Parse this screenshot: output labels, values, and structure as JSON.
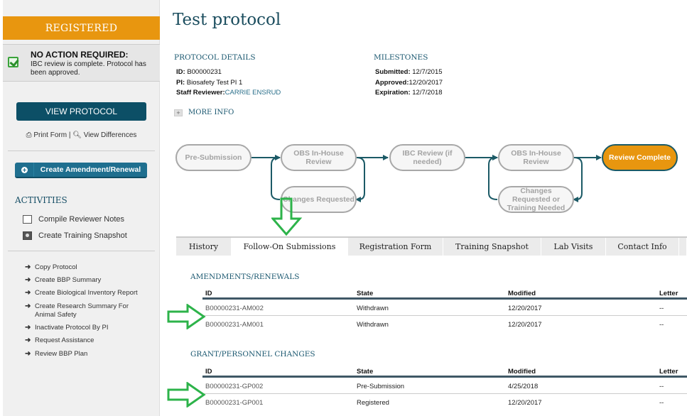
{
  "sidebar": {
    "status": "REGISTERED",
    "notice": {
      "title": "NO ACTION REQUIRED:",
      "body": "IBC review is complete. Protocol has been approved."
    },
    "view_protocol_label": "VIEW PROTOCOL",
    "print_form_label": "Print Form",
    "separator": "|",
    "view_differences_label": "View Differences",
    "create_amendment_label": "Create Amendment/Renewal",
    "activities_title": "ACTIVITIES",
    "activities": [
      {
        "label": "Compile Reviewer Notes",
        "icon": "note-icon"
      },
      {
        "label": "Create Training Snapshot",
        "icon": "camera-icon"
      }
    ],
    "links": [
      {
        "label": "Copy Protocol"
      },
      {
        "label": "Create BBP Summary"
      },
      {
        "label": "Create Biological Inventory Report"
      },
      {
        "label": "Create Research Summary For Animal Safety"
      },
      {
        "label": "Inactivate Protocol By PI"
      },
      {
        "label": "Request Assistance"
      },
      {
        "label": "Review BBP Plan"
      }
    ]
  },
  "main": {
    "title": "Test protocol",
    "protocol_details": {
      "heading": "PROTOCOL DETAILS",
      "id_label": "ID:",
      "id_value": "B00000231",
      "pi_label": "PI:",
      "pi_value": "Biosafety Test PI 1",
      "reviewer_label": "Staff Reviewer:",
      "reviewer_value": "CARRIE ENSRUD"
    },
    "milestones": {
      "heading": "MILESTONES",
      "submitted_label": "Submitted:",
      "submitted_value": "12/7/2015",
      "approved_label": "Approved:",
      "approved_value": "12/20/2017",
      "expiration_label": "Expiration:",
      "expiration_value": "12/7/2018"
    },
    "more_info_label": "MORE INFO",
    "workflow": {
      "steps": [
        {
          "label": "Pre-Submission",
          "state": "inactive"
        },
        {
          "label": "OBS In-House Review",
          "state": "inactive"
        },
        {
          "label": "Changes Requested",
          "state": "inactive"
        },
        {
          "label": "IBC Review (if needed)",
          "state": "inactive"
        },
        {
          "label": "OBS In-House Review",
          "state": "inactive"
        },
        {
          "label": "Changes Requested or Training Needed",
          "state": "inactive"
        },
        {
          "label": "Review Complete",
          "state": "active"
        }
      ],
      "active_color": "#e8960f"
    },
    "tabs": [
      {
        "label": "History",
        "active": false
      },
      {
        "label": "Follow-On Submissions",
        "active": true
      },
      {
        "label": "Registration Form",
        "active": false
      },
      {
        "label": "Training Snapshot",
        "active": false
      },
      {
        "label": "Lab Visits",
        "active": false
      },
      {
        "label": "Contact Info",
        "active": false
      }
    ],
    "amendments": {
      "title": "AMENDMENTS/RENEWALS",
      "columns": [
        "ID",
        "State",
        "Modified",
        "Letter"
      ],
      "rows": [
        {
          "id": "B00000231-AM002",
          "state": "Withdrawn",
          "modified": "12/20/2017",
          "letter": "--"
        },
        {
          "id": "B00000231-AM001",
          "state": "Withdrawn",
          "modified": "12/20/2017",
          "letter": "--"
        }
      ]
    },
    "grant_changes": {
      "title": "GRANT/PERSONNEL CHANGES",
      "columns": [
        "ID",
        "State",
        "Modified",
        "Letter"
      ],
      "rows": [
        {
          "id": "B00000231-GP002",
          "state": "Pre-Submission",
          "modified": "4/25/2018",
          "letter": "--"
        },
        {
          "id": "B00000231-GP001",
          "state": "Registered",
          "modified": "12/20/2017",
          "letter": "--"
        }
      ]
    }
  },
  "annotation_color": "#2db34a"
}
